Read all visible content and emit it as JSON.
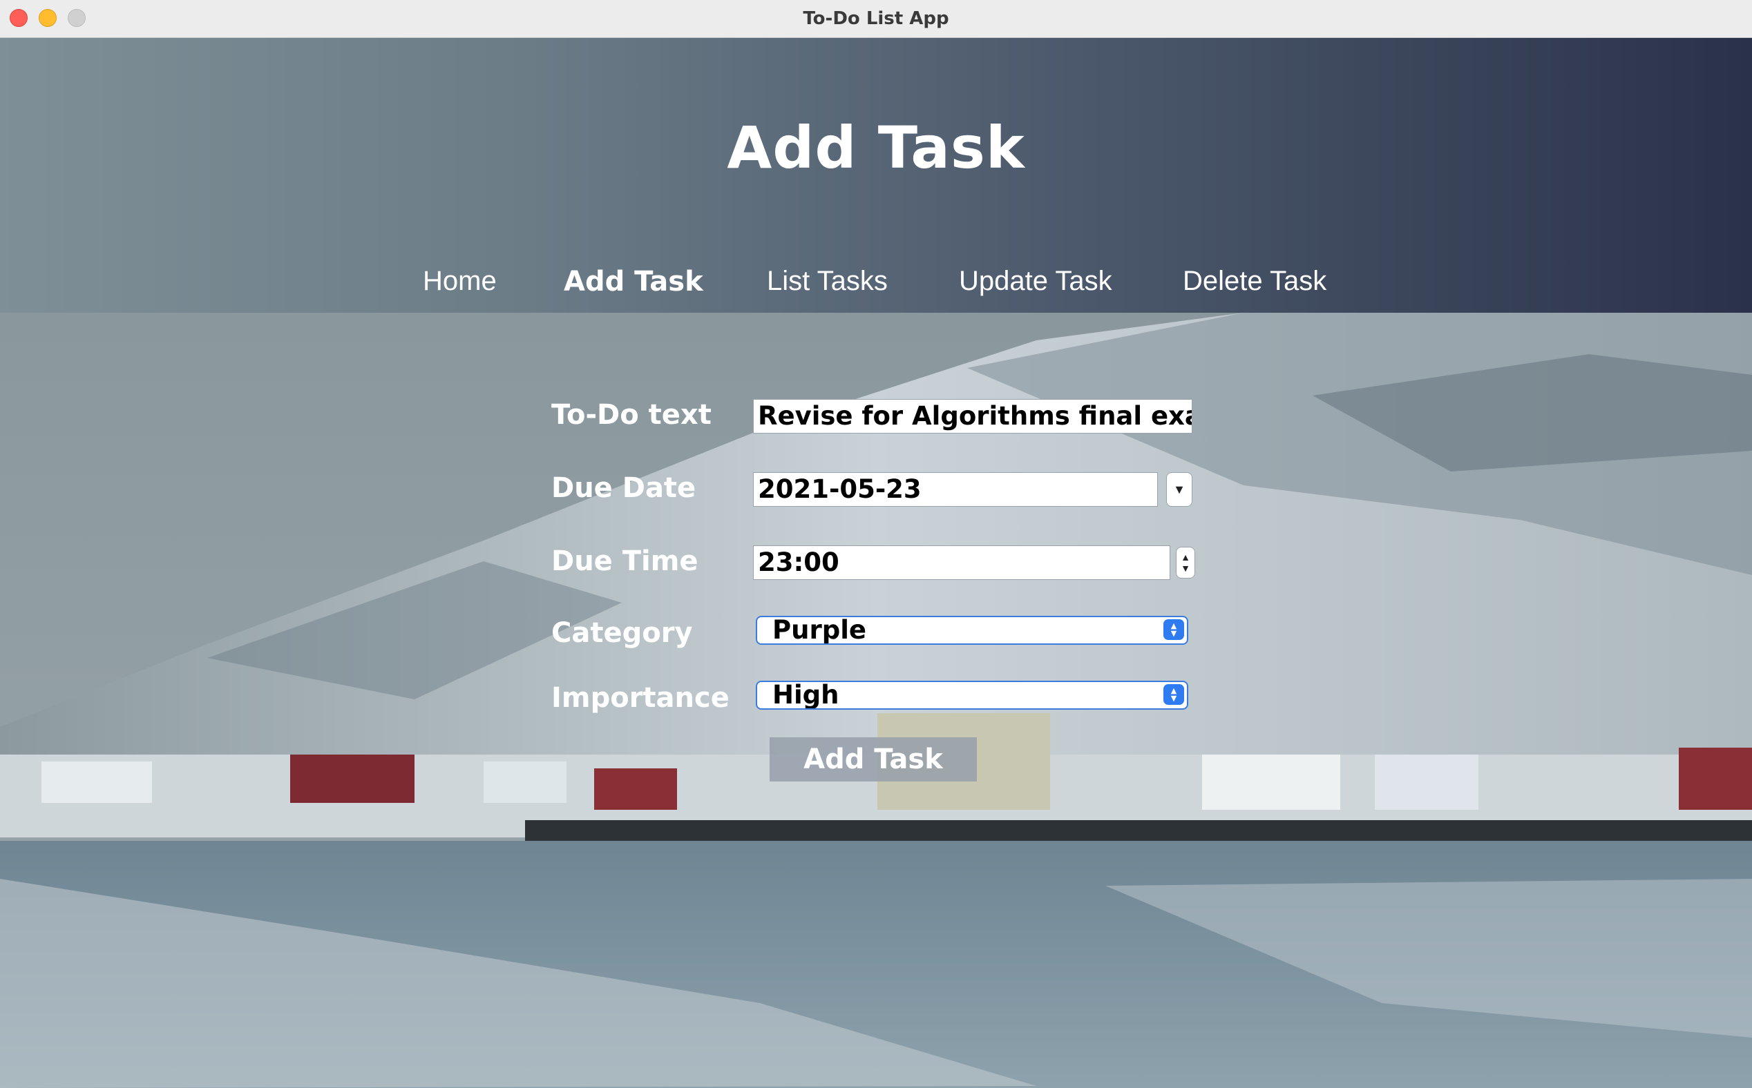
{
  "window": {
    "title": "To-Do List App"
  },
  "header": {
    "title": "Add Task"
  },
  "nav": {
    "items": [
      {
        "label": "Home"
      },
      {
        "label": "Add Task",
        "active": true
      },
      {
        "label": "List Tasks"
      },
      {
        "label": "Update Task"
      },
      {
        "label": "Delete Task"
      }
    ]
  },
  "form": {
    "todo_text": {
      "label": "To-Do text",
      "value": "Revise for Algorithms final exam"
    },
    "due_date": {
      "label": "Due Date",
      "value": "2021-05-23"
    },
    "due_time": {
      "label": "Due Time",
      "value": "23:00"
    },
    "category": {
      "label": "Category",
      "value": "Purple"
    },
    "importance": {
      "label": "Importance",
      "value": "High"
    },
    "submit_label": "Add Task"
  },
  "icons": {
    "close": "close-icon",
    "minimize": "minimize-icon",
    "zoom": "zoom-icon",
    "date_dropdown": "chevron-down-icon",
    "time_spinner": "up-down-arrows-icon",
    "select_arrows": "up-down-chevron-icon"
  },
  "colors": {
    "header_gradient_start": "#7e8f97",
    "header_gradient_end": "#2a3249",
    "select_accent": "#2f7bf2"
  }
}
